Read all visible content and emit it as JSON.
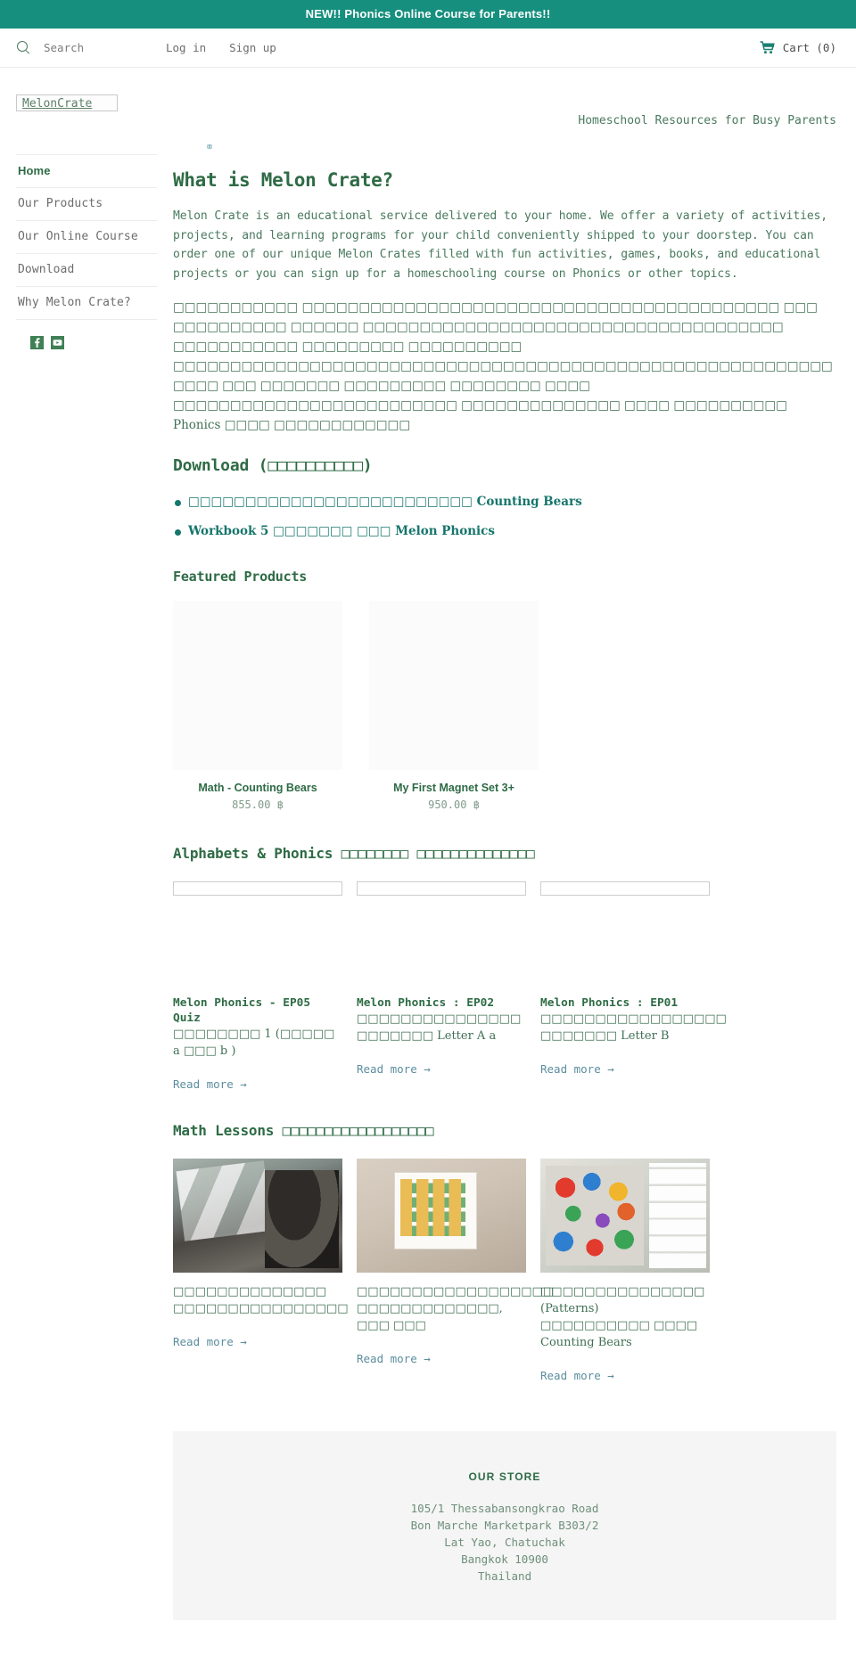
{
  "announcement": {
    "text": "NEW!! Phonics Online Course for Parents!!"
  },
  "topbar": {
    "search_label": "Search",
    "login_label": "Log in",
    "signup_label": "Sign up",
    "cart_label": "Cart (0)"
  },
  "masthead": {
    "logo_alt": "MelonCrate",
    "tagline": "Homeschool Resources for Busy Parents"
  },
  "sidebar": {
    "items": [
      {
        "label": "Home",
        "active": true
      },
      {
        "label": "Our Products",
        "active": false
      },
      {
        "label": "Our Online Course",
        "active": false
      },
      {
        "label": "Download",
        "active": false
      },
      {
        "label": "Why Melon Crate?",
        "active": false
      }
    ],
    "social": [
      {
        "name": "facebook",
        "label": "Facebook"
      },
      {
        "name": "youtube",
        "label": "YouTube"
      }
    ]
  },
  "main": {
    "broken_image_glyph": "⌧",
    "heading": "What is Melon Crate?",
    "paragraph_en": "Melon Crate is an educational service delivered to your home. We offer a variety of activities, projects, and learning programs for your child conveniently shipped to your doorstep. You can order one of our unique Melon Crates filled with fun activities, games, books, and educational projects or you can sign up for a homeschooling course on Phonics or other topics.",
    "paragraph_th": "□□□□□□□□□□□ □□□□□□□□□□□□□□□□□□□□□□□□□□□□□□□□□□□□□□□□□□ □□□ □□□□□□□□□□ □□□□□□ □□□□□□□□□□□□□□□□□□□□□□□□□□□□□□□□□□□□□ □□□□□□□□□□□ □□□□□□□□□ □□□□□□□□□□ □□□□□□□□□□□□□□□□□□□□□□□□□□□□□□□□□□□□□□□□□□□□□□□□□□□□□□□□□□□□□□ □□□ □□□□□□□ □□□□□□□□□ □□□□□□□□ □□□□ □□□□□□□□□□□□□□□□□□□□□□□□□ □□□□□□□□□□□□□□ □□□□ □□□□□□□□□□ Phonics □□□□ □□□□□□□□□□□□"
  },
  "download": {
    "title": "Download (□□□□□□□□□□)",
    "items": [
      {
        "text": "□□□□□□□□□□□□□□□□□□□□□□□□□ Counting Bears"
      },
      {
        "text": "Workbook 5 □□□□□□□ □□□ Melon Phonics"
      }
    ]
  },
  "featured": {
    "title": "Featured Products",
    "products": [
      {
        "name": "Math - Counting Bears",
        "price": "855.00 ฿"
      },
      {
        "name": "My First Magnet Set 3+",
        "price": "950.00 ฿"
      }
    ]
  },
  "phonics": {
    "title": "Alphabets & Phonics □□□□□□□□ □□□□□□□□□□□□□□",
    "read_more": "Read more →",
    "articles": [
      {
        "title_en": "Melon Phonics - EP05 Quiz",
        "title_th": "□□□□□□□□ 1 (□□□□□ a □□□ b )"
      },
      {
        "title_en": "Melon Phonics : EP02",
        "title_th": "□□□□□□□□□□□□□□□ □□□□□□□ Letter A a"
      },
      {
        "title_en": "Melon Phonics : EP01",
        "title_th": "□□□□□□□□□□□□□□□□□ □□□□□□□ Letter B"
      }
    ]
  },
  "math": {
    "title": "Math Lessons □□□□□□□□□□□□□□□□□□",
    "read_more": "Read more →",
    "articles": [
      {
        "photo": "photo-1",
        "excerpt_th": "□□□□□□□□□□□□□□ □□□□□□□□□□□□□□□□"
      },
      {
        "photo": "photo-2",
        "excerpt_th": "□□□□□□□□□□□□□□□□□□ □□□□□□□□□□□□□, □□□ □□□"
      },
      {
        "photo": "photo-3",
        "excerpt_th": "□□□□□□□□□□□□□□□ (Patterns) □□□□□□□□□□ □□□□ Counting Bears"
      }
    ]
  },
  "footer": {
    "heading": "OUR STORE",
    "address_lines": [
      "105/1 Thessabansongkrao Road",
      "Bon Marche Marketpark B303/2",
      "Lat Yao, Chatuchak",
      "Bangkok 10900",
      "Thailand"
    ]
  }
}
